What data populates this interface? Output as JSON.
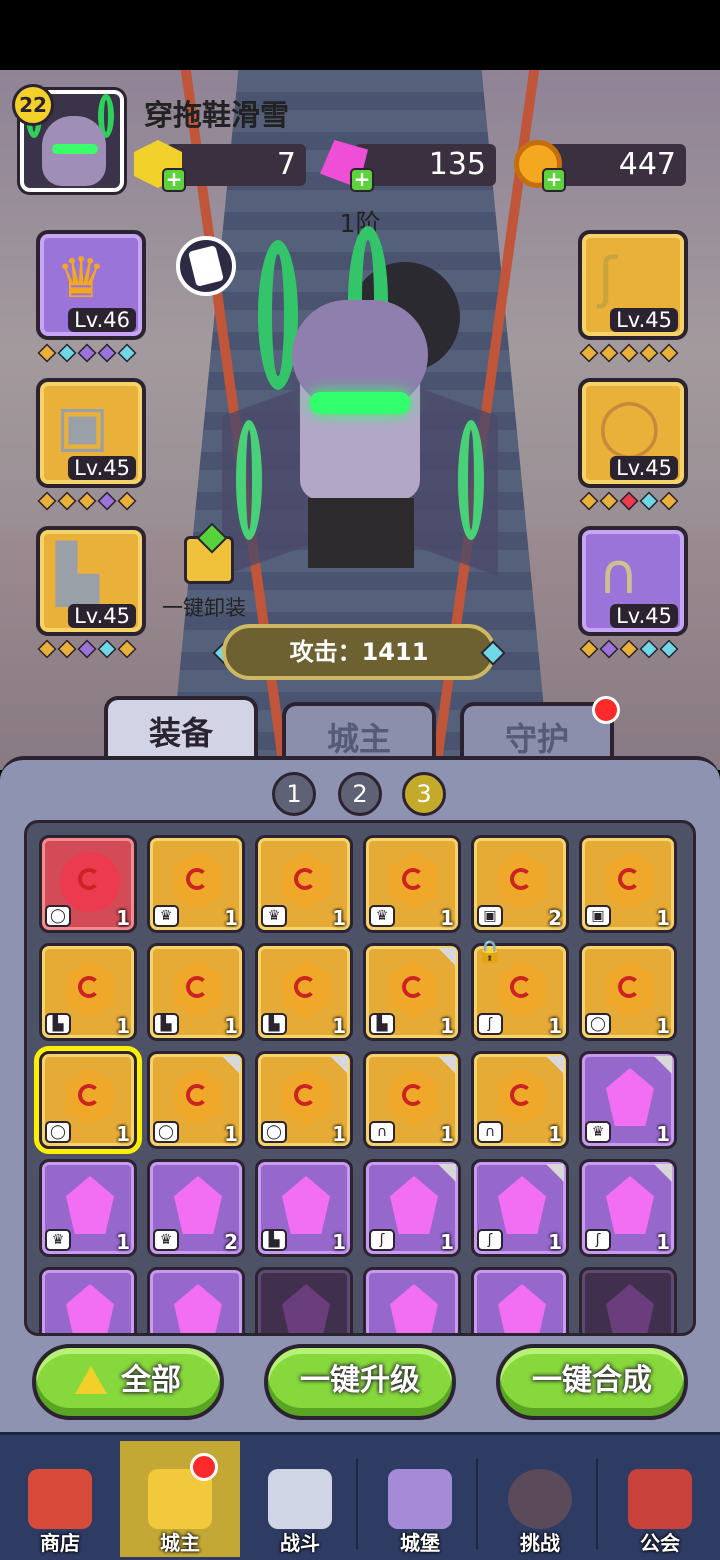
{
  "player": {
    "level": "22",
    "name": "穿拖鞋滑雪",
    "rank": "1阶"
  },
  "resources": [
    {
      "name": "gold-gem",
      "value": "7",
      "color": "#f2d12a"
    },
    {
      "name": "pink-gem",
      "value": "135",
      "color": "#ee4fd6"
    },
    {
      "name": "gold-coin",
      "value": "447",
      "color": "#f3a81f"
    }
  ],
  "equipment": {
    "crown": {
      "level": "Lv.46"
    },
    "armor": {
      "level": "Lv.45"
    },
    "boots": {
      "level": "Lv.45"
    },
    "staff": {
      "level": "Lv.45"
    },
    "ring": {
      "level": "Lv.45"
    },
    "amulet": {
      "level": "Lv.45"
    }
  },
  "actions": {
    "unload_all": "一键卸装",
    "attack": "攻击：1411"
  },
  "tabs": [
    "装备",
    "城主",
    "守护"
  ],
  "pages": [
    "1",
    "2",
    "3"
  ],
  "inventory": {
    "rows": [
      [
        {
          "q": "red",
          "t": "ring",
          "n": "1"
        },
        {
          "q": "gold",
          "t": "crown",
          "n": "1"
        },
        {
          "q": "gold",
          "t": "crown",
          "n": "1"
        },
        {
          "q": "gold",
          "t": "crown",
          "n": "1"
        },
        {
          "q": "gold",
          "t": "armor",
          "n": "2"
        },
        {
          "q": "gold",
          "t": "armor",
          "n": "1"
        }
      ],
      [
        {
          "q": "gold",
          "t": "boots",
          "n": "1"
        },
        {
          "q": "gold",
          "t": "boots",
          "n": "1"
        },
        {
          "q": "gold",
          "t": "boots",
          "n": "1"
        },
        {
          "q": "gold",
          "t": "boots",
          "n": "1"
        },
        {
          "q": "gold",
          "t": "staff",
          "n": "1",
          "locked": true
        },
        {
          "q": "gold",
          "t": "ring",
          "n": "1"
        }
      ],
      [
        {
          "q": "gold",
          "t": "ring",
          "n": "1",
          "selected": true
        },
        {
          "q": "gold",
          "t": "ring",
          "n": "1"
        },
        {
          "q": "gold",
          "t": "ring",
          "n": "1"
        },
        {
          "q": "gold",
          "t": "amulet",
          "n": "1"
        },
        {
          "q": "gold",
          "t": "amulet",
          "n": "1"
        },
        {
          "q": "purple",
          "t": "crown",
          "n": "1"
        }
      ],
      [
        {
          "q": "purple",
          "t": "crown",
          "n": "1"
        },
        {
          "q": "purple",
          "t": "crown",
          "n": "2"
        },
        {
          "q": "purple",
          "t": "boots",
          "n": "1"
        },
        {
          "q": "purple",
          "t": "staff",
          "n": "1"
        },
        {
          "q": "purple",
          "t": "staff",
          "n": "1"
        },
        {
          "q": "purple",
          "t": "staff",
          "n": "1"
        }
      ],
      [
        {
          "q": "purple",
          "t": "",
          "n": ""
        },
        {
          "q": "purple",
          "t": "",
          "n": ""
        },
        {
          "q": "dark",
          "t": "",
          "n": ""
        },
        {
          "q": "purple",
          "t": "",
          "n": ""
        },
        {
          "q": "purple",
          "t": "",
          "n": ""
        },
        {
          "q": "dark",
          "t": "",
          "n": ""
        }
      ]
    ]
  },
  "buttons": {
    "all": "全部",
    "upgrade_all": "一键升级",
    "merge_all": "一键合成"
  },
  "nav": [
    "商店",
    "城主",
    "战斗",
    "城堡",
    "挑战",
    "公会"
  ]
}
